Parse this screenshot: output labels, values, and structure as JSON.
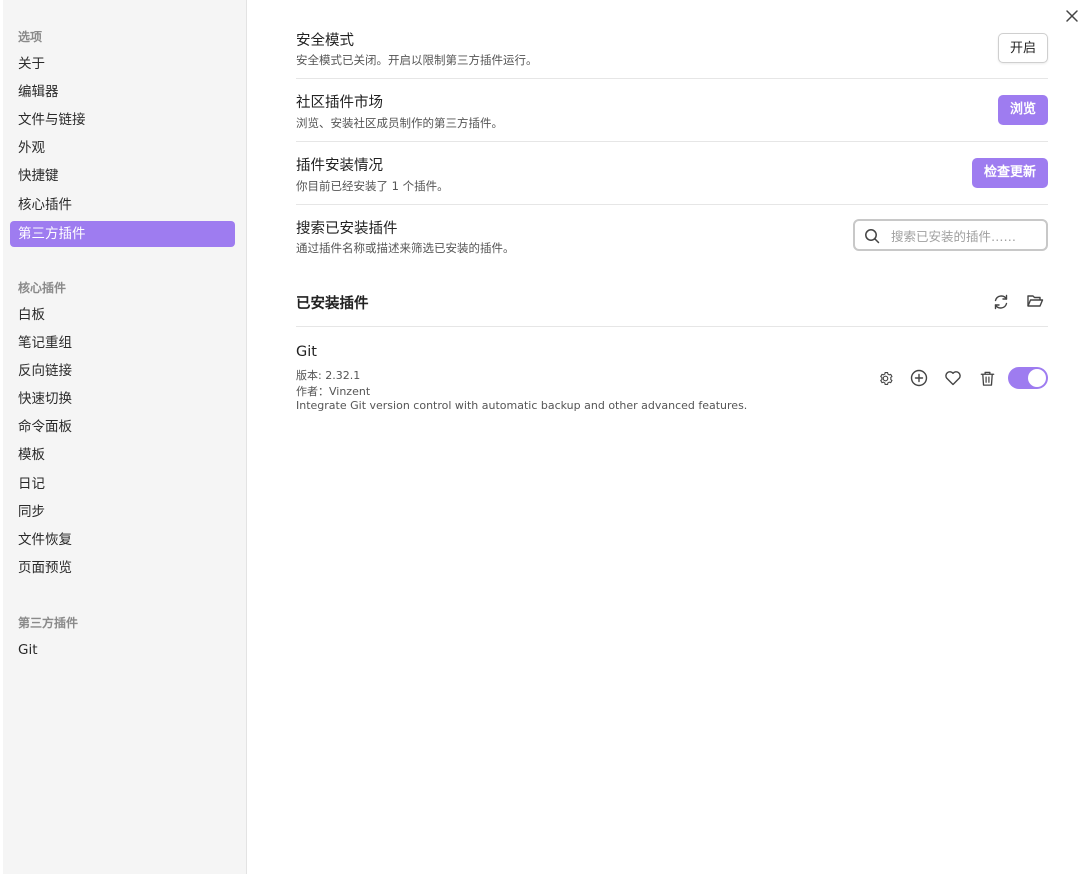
{
  "sidebar": {
    "options_title": "选项",
    "options": [
      "关于",
      "编辑器",
      "文件与链接",
      "外观",
      "快捷键",
      "核心插件",
      "第三方插件"
    ],
    "core_title": "核心插件",
    "core": [
      "白板",
      "笔记重组",
      "反向链接",
      "快速切换",
      "命令面板",
      "模板",
      "日记",
      "同步",
      "文件恢复",
      "页面预览"
    ],
    "community_title": "第三方插件",
    "community": [
      "Git"
    ]
  },
  "settings": {
    "safe_mode": {
      "name": "安全模式",
      "desc": "安全模式已关闭。开启以限制第三方插件运行。",
      "button": "开启"
    },
    "market": {
      "name": "社区插件市场",
      "desc": "浏览、安装社区成员制作的第三方插件。",
      "button": "浏览"
    },
    "installed_status": {
      "name": "插件安装情况",
      "desc": "你目前已经安装了 1 个插件。",
      "button": "检查更新"
    },
    "search": {
      "name": "搜索已安装插件",
      "desc": "通过插件名称或描述来筛选已安装的插件。",
      "placeholder": "搜索已安装的插件……"
    }
  },
  "installed": {
    "title": "已安装插件",
    "plugins": [
      {
        "name": "Git",
        "version": "版本: 2.32.1",
        "author": "作者：Vinzent",
        "description": "Integrate Git version control with automatic backup and other advanced features.",
        "enabled": true
      }
    ]
  },
  "colors": {
    "accent": "#9e7cf0",
    "sidebar_bg": "#f5f5f5"
  }
}
